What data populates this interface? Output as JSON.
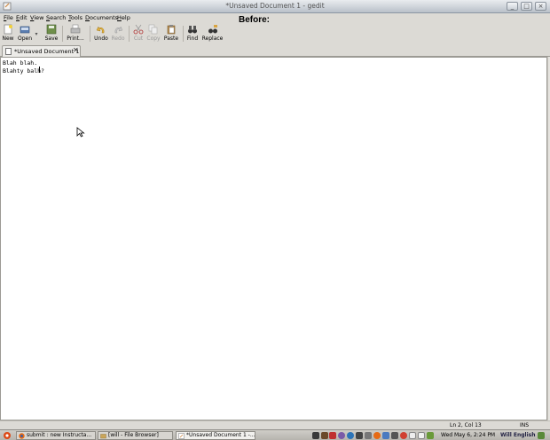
{
  "window": {
    "title": "*Unsaved Document 1 - gedit"
  },
  "overlay": {
    "before_label": "Before:"
  },
  "menu": {
    "items": [
      {
        "u": "F",
        "rest": "ile"
      },
      {
        "u": "E",
        "rest": "dit"
      },
      {
        "u": "V",
        "rest": "iew"
      },
      {
        "u": "S",
        "rest": "earch"
      },
      {
        "u": "T",
        "rest": "ools"
      },
      {
        "u": "D",
        "rest": "ocuments"
      },
      {
        "u": "H",
        "rest": "elp"
      }
    ]
  },
  "toolbar": {
    "new": "New",
    "open": "Open",
    "save": "Save",
    "print": "Print...",
    "undo": "Undo",
    "redo": "Redo",
    "cut": "Cut",
    "copy": "Copy",
    "paste": "Paste",
    "find": "Find",
    "replace": "Replace"
  },
  "tab": {
    "label": "*Unsaved Document 1",
    "close": "✕"
  },
  "document": {
    "lines": [
      "Blah blah.",
      "Blahty balh?"
    ]
  },
  "status": {
    "position": "Ln 2, Col 13",
    "mode": "INS"
  },
  "taskbar": {
    "tasks": [
      "submit : new Instructa...",
      "[will - File Browser]",
      "*Unsaved Document 1 -..."
    ],
    "clock": "Wed May  6,  2:24 PM",
    "user": "Will English"
  },
  "colors": {
    "accent": "#3c6eb4",
    "titlebar": "#b9c0c9",
    "editor_bg": "#ffffff"
  }
}
